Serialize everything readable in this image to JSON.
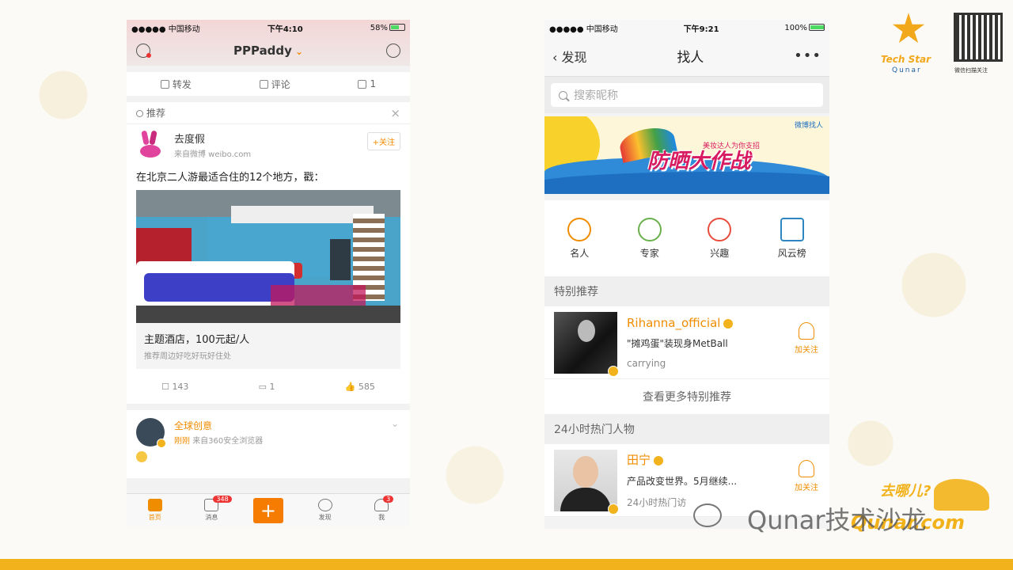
{
  "phone1": {
    "status": {
      "carrier": "●●●●● 中国移动",
      "time": "下午4:10",
      "battery": "58%"
    },
    "nav": {
      "title": "PPPaddy"
    },
    "actions": {
      "repost": "转发",
      "comment": "评论",
      "like": "1"
    },
    "rec": {
      "label": "推荐"
    },
    "post": {
      "user": "去度假",
      "source": "来自微博 weibo.com",
      "follow": "+关注",
      "text": "在北京二人游最适合住的12个地方，戳：",
      "caption_title": "主题酒店，100元起/人",
      "caption_sub": "推荐周边好吃好玩好住处",
      "stats": {
        "reposts": "143",
        "comments": "1",
        "likes": "585"
      }
    },
    "post2": {
      "user": "全球创意",
      "time": "刚刚",
      "source": "来自360安全浏览器"
    },
    "tabbar": [
      {
        "label": "首页",
        "badge": ""
      },
      {
        "label": "消息",
        "badge": "348"
      },
      {
        "label": "",
        "badge": ""
      },
      {
        "label": "发现",
        "badge": ""
      },
      {
        "label": "我",
        "badge": "3"
      }
    ]
  },
  "phone2": {
    "status": {
      "carrier": "●●●●● 中国移动",
      "time": "下午9:21",
      "battery": "100%"
    },
    "nav": {
      "back": "发现",
      "title": "找人",
      "more": "•••"
    },
    "search": {
      "placeholder": "搜索昵称"
    },
    "banner": {
      "tag": "微博找人",
      "small": "美妆达人为你支招",
      "big": "防晒大作战"
    },
    "categories": [
      {
        "label": "名人",
        "color": "#f08c00"
      },
      {
        "label": "专家",
        "color": "#6ab04c"
      },
      {
        "label": "兴趣",
        "color": "#e74c3c"
      },
      {
        "label": "风云榜",
        "color": "#2e86c1"
      }
    ],
    "sections": {
      "special": "特别推荐",
      "hot": "24小时热门人物"
    },
    "people": [
      {
        "name": "Rihanna_official",
        "desc": "\"摊鸡蛋\"装现身MetBall",
        "tag": "carrying",
        "follow": "加关注"
      },
      {
        "name": "田宁",
        "desc": "产品改变世界。5月继续...",
        "tag": "24小时热门访",
        "follow": "加关注"
      }
    ],
    "view_more": "查看更多特别推荐"
  },
  "brand": {
    "logo_line1": "Tech Star",
    "logo_line2": "Qunar",
    "qr_caption": "微信扫描关注",
    "mark": "去哪儿?",
    "mark2": "Qunar.com",
    "watermark": "Qunar技术沙龙"
  }
}
